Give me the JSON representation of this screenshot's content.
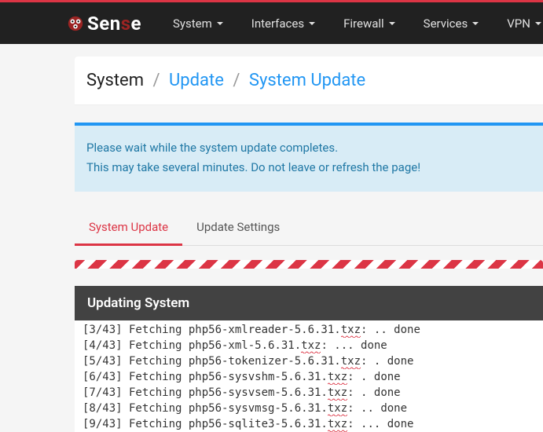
{
  "brand": {
    "name": "Sense"
  },
  "nav": {
    "items": [
      {
        "label": "System"
      },
      {
        "label": "Interfaces"
      },
      {
        "label": "Firewall"
      },
      {
        "label": "Services"
      },
      {
        "label": "VPN"
      }
    ]
  },
  "breadcrumb": {
    "part1": "System",
    "part2": "Update",
    "part3": "System Update"
  },
  "alert": {
    "line1": "Please wait while the system update completes.",
    "line2": "This may take several minutes. Do not leave or refresh the page!"
  },
  "tabs": {
    "items": [
      {
        "label": "System Update",
        "active": true
      },
      {
        "label": "Update Settings",
        "active": false
      }
    ]
  },
  "panel": {
    "title": "Updating System"
  },
  "terminal": {
    "lines": [
      {
        "prefix": "[3/43] Fetching php56-xmlreader-5.6.31.",
        "ext": "txz",
        "suffix": ": .. done"
      },
      {
        "prefix": "[4/43] Fetching php56-xml-5.6.31.",
        "ext": "txz",
        "suffix": ": ... done"
      },
      {
        "prefix": "[5/43] Fetching php56-tokenizer-5.6.31.",
        "ext": "txz",
        "suffix": ": . done"
      },
      {
        "prefix": "[6/43] Fetching php56-sysvshm-5.6.31.",
        "ext": "txz",
        "suffix": ": . done"
      },
      {
        "prefix": "[7/43] Fetching php56-sysvsem-5.6.31.",
        "ext": "txz",
        "suffix": ": . done"
      },
      {
        "prefix": "[8/43] Fetching php56-sysvmsg-5.6.31.",
        "ext": "txz",
        "suffix": ": .. done"
      },
      {
        "prefix": "[9/43] Fetching php56-sqlite3-5.6.31.",
        "ext": "txz",
        "suffix": ": ... done"
      }
    ]
  }
}
